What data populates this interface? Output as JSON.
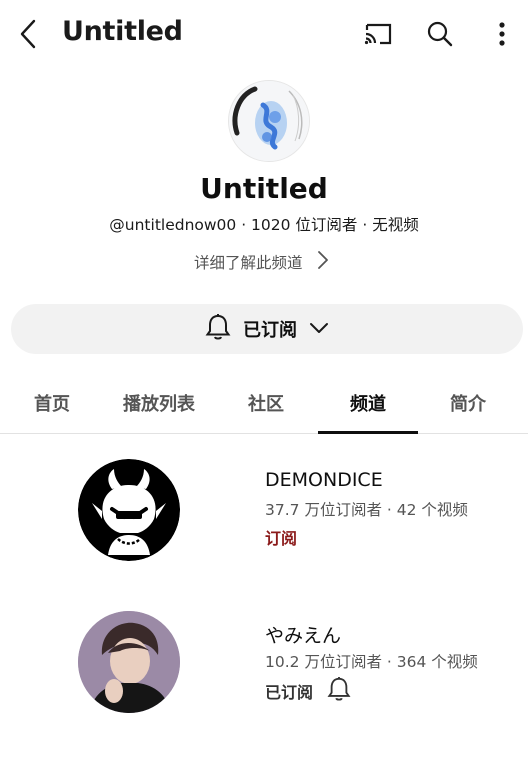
{
  "topbar": {
    "title": "Untitled",
    "icons": [
      "back-arrow-icon",
      "cast-icon",
      "search-icon",
      "more-vert-icon"
    ]
  },
  "channel": {
    "name": "Untitled",
    "meta": "@untitlednow00 · 1020 位订阅者 · 无视频",
    "about_label": "详细了解此频道"
  },
  "subscribe": {
    "label": "已订阅",
    "icons": [
      "bell-icon",
      "chevron-down-icon"
    ]
  },
  "tabs": [
    {
      "label": "首页",
      "active": false
    },
    {
      "label": "播放列表",
      "active": false
    },
    {
      "label": "社区",
      "active": false
    },
    {
      "label": "频道",
      "active": true
    },
    {
      "label": "简介",
      "active": false
    }
  ],
  "channels": [
    {
      "name": "DEMONDICE",
      "meta": "37.7 万位订阅者 · 42 个视频",
      "action": "订阅",
      "action_color": "#8b1a1a"
    },
    {
      "name": "やみえん",
      "meta": "10.2 万位订阅者 · 364 个视频",
      "action": "已订阅",
      "action_color": "#333333"
    }
  ]
}
